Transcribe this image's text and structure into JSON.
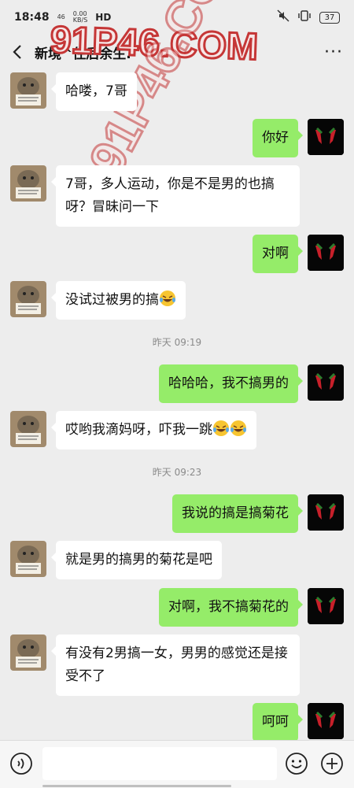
{
  "status_bar": {
    "time": "18:48",
    "net_top": "46",
    "net_speed": "0.00",
    "net_unit": "KB/S",
    "hd": "HD",
    "battery": "37"
  },
  "header": {
    "title": "新境^住后余生."
  },
  "watermark": {
    "text": "91P46.COM"
  },
  "messages": [
    {
      "side": "left",
      "text": "哈喽，7哥"
    },
    {
      "side": "right",
      "text": "你好"
    },
    {
      "side": "left",
      "text": "7哥，多人运动，你是不是男的也搞呀？冒昧问一下"
    },
    {
      "side": "right",
      "text": "对啊"
    },
    {
      "side": "left",
      "text": "没试过被男的搞",
      "emoji": "laugh-cry-emoji"
    },
    {
      "side": "time",
      "text": "昨天 09:19"
    },
    {
      "side": "right",
      "text": "哈哈哈，我不搞男的"
    },
    {
      "side": "left",
      "text": "哎哟我滴妈呀，吓我一跳",
      "emoji": "laugh-cry-emoji x2"
    },
    {
      "side": "time",
      "text": "昨天 09:23"
    },
    {
      "side": "right",
      "text": "我说的搞是搞菊花"
    },
    {
      "side": "left",
      "text": "就是男的搞男的菊花是吧"
    },
    {
      "side": "right",
      "text": "对啊，我不搞菊花的"
    },
    {
      "side": "left",
      "text": "有没有2男搞一女，男男的感觉还是接受不了"
    },
    {
      "side": "right",
      "text": "呵呵"
    }
  ],
  "input_bar": {
    "value": "",
    "icons": [
      "voice-icon",
      "emoji-icon",
      "plus-icon"
    ]
  },
  "colors": {
    "background": "#ededed",
    "self_bubble": "#95ec69",
    "other_bubble": "#ffffff"
  }
}
